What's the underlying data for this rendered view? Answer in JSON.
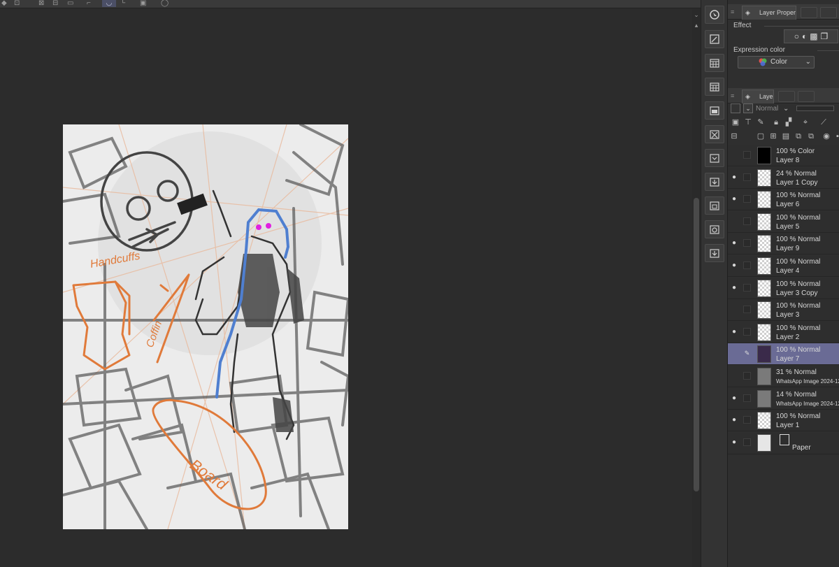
{
  "top_toolbar": {
    "icons": [
      "select-rect-icon",
      "transform-icon",
      "lasso-icon",
      "grid-icon",
      "ruler-icon",
      "curve-icon",
      "angle-icon",
      "layer-icon",
      "chat-icon"
    ]
  },
  "layer_property_panel": {
    "tab_label": "Layer Propert",
    "effect_label": "Effect",
    "expression_color_label": "Expression color",
    "expression_color_value": "Color"
  },
  "layer_panel": {
    "tab_label": "Layer",
    "blend_mode": "Normal",
    "layers": [
      {
        "mode": "100 % Color",
        "name": "Layer 8",
        "visible": false,
        "thumb": "black",
        "selected": false
      },
      {
        "mode": "24 % Normal",
        "name": "Layer 1 Copy",
        "visible": true,
        "thumb": "checker",
        "selected": false
      },
      {
        "mode": "100 % Normal",
        "name": "Layer 6",
        "visible": true,
        "thumb": "checker",
        "selected": false
      },
      {
        "mode": "100 % Normal",
        "name": "Layer 5",
        "visible": false,
        "thumb": "checker",
        "selected": false
      },
      {
        "mode": "100 % Normal",
        "name": "Layer 9",
        "visible": true,
        "thumb": "checker",
        "selected": false
      },
      {
        "mode": "100 % Normal",
        "name": "Layer 4",
        "visible": true,
        "thumb": "checker",
        "selected": false
      },
      {
        "mode": "100 % Normal",
        "name": "Layer 3 Copy",
        "visible": true,
        "thumb": "checker",
        "selected": false
      },
      {
        "mode": "100 % Normal",
        "name": "Layer 3",
        "visible": false,
        "thumb": "checker",
        "selected": false
      },
      {
        "mode": "100 % Normal",
        "name": "Layer 2",
        "visible": true,
        "thumb": "checker",
        "selected": false
      },
      {
        "mode": "100 % Normal",
        "name": "Layer 7",
        "visible": false,
        "thumb": "dark",
        "selected": true
      },
      {
        "mode": "31 % Normal",
        "name": "WhatsApp Image 2024-12-0",
        "visible": false,
        "thumb": "photo",
        "selected": false
      },
      {
        "mode": "14 % Normal",
        "name": "WhatsApp Image 2024-12-0",
        "visible": true,
        "thumb": "photo",
        "selected": false
      },
      {
        "mode": "100 % Normal",
        "name": "Layer 1",
        "visible": true,
        "thumb": "checker",
        "selected": false
      }
    ],
    "paper_layer_name": "Paper"
  },
  "canvas": {
    "annotation_1": "Handcuffs",
    "annotation_2": "Coffin",
    "annotation_3": "Board"
  },
  "colors": {
    "accent_selected": "#6a6b95",
    "sketch_orange": "#e07a3a",
    "sketch_blue": "#4f7fd0",
    "eye_magenta": "#e020e0"
  }
}
